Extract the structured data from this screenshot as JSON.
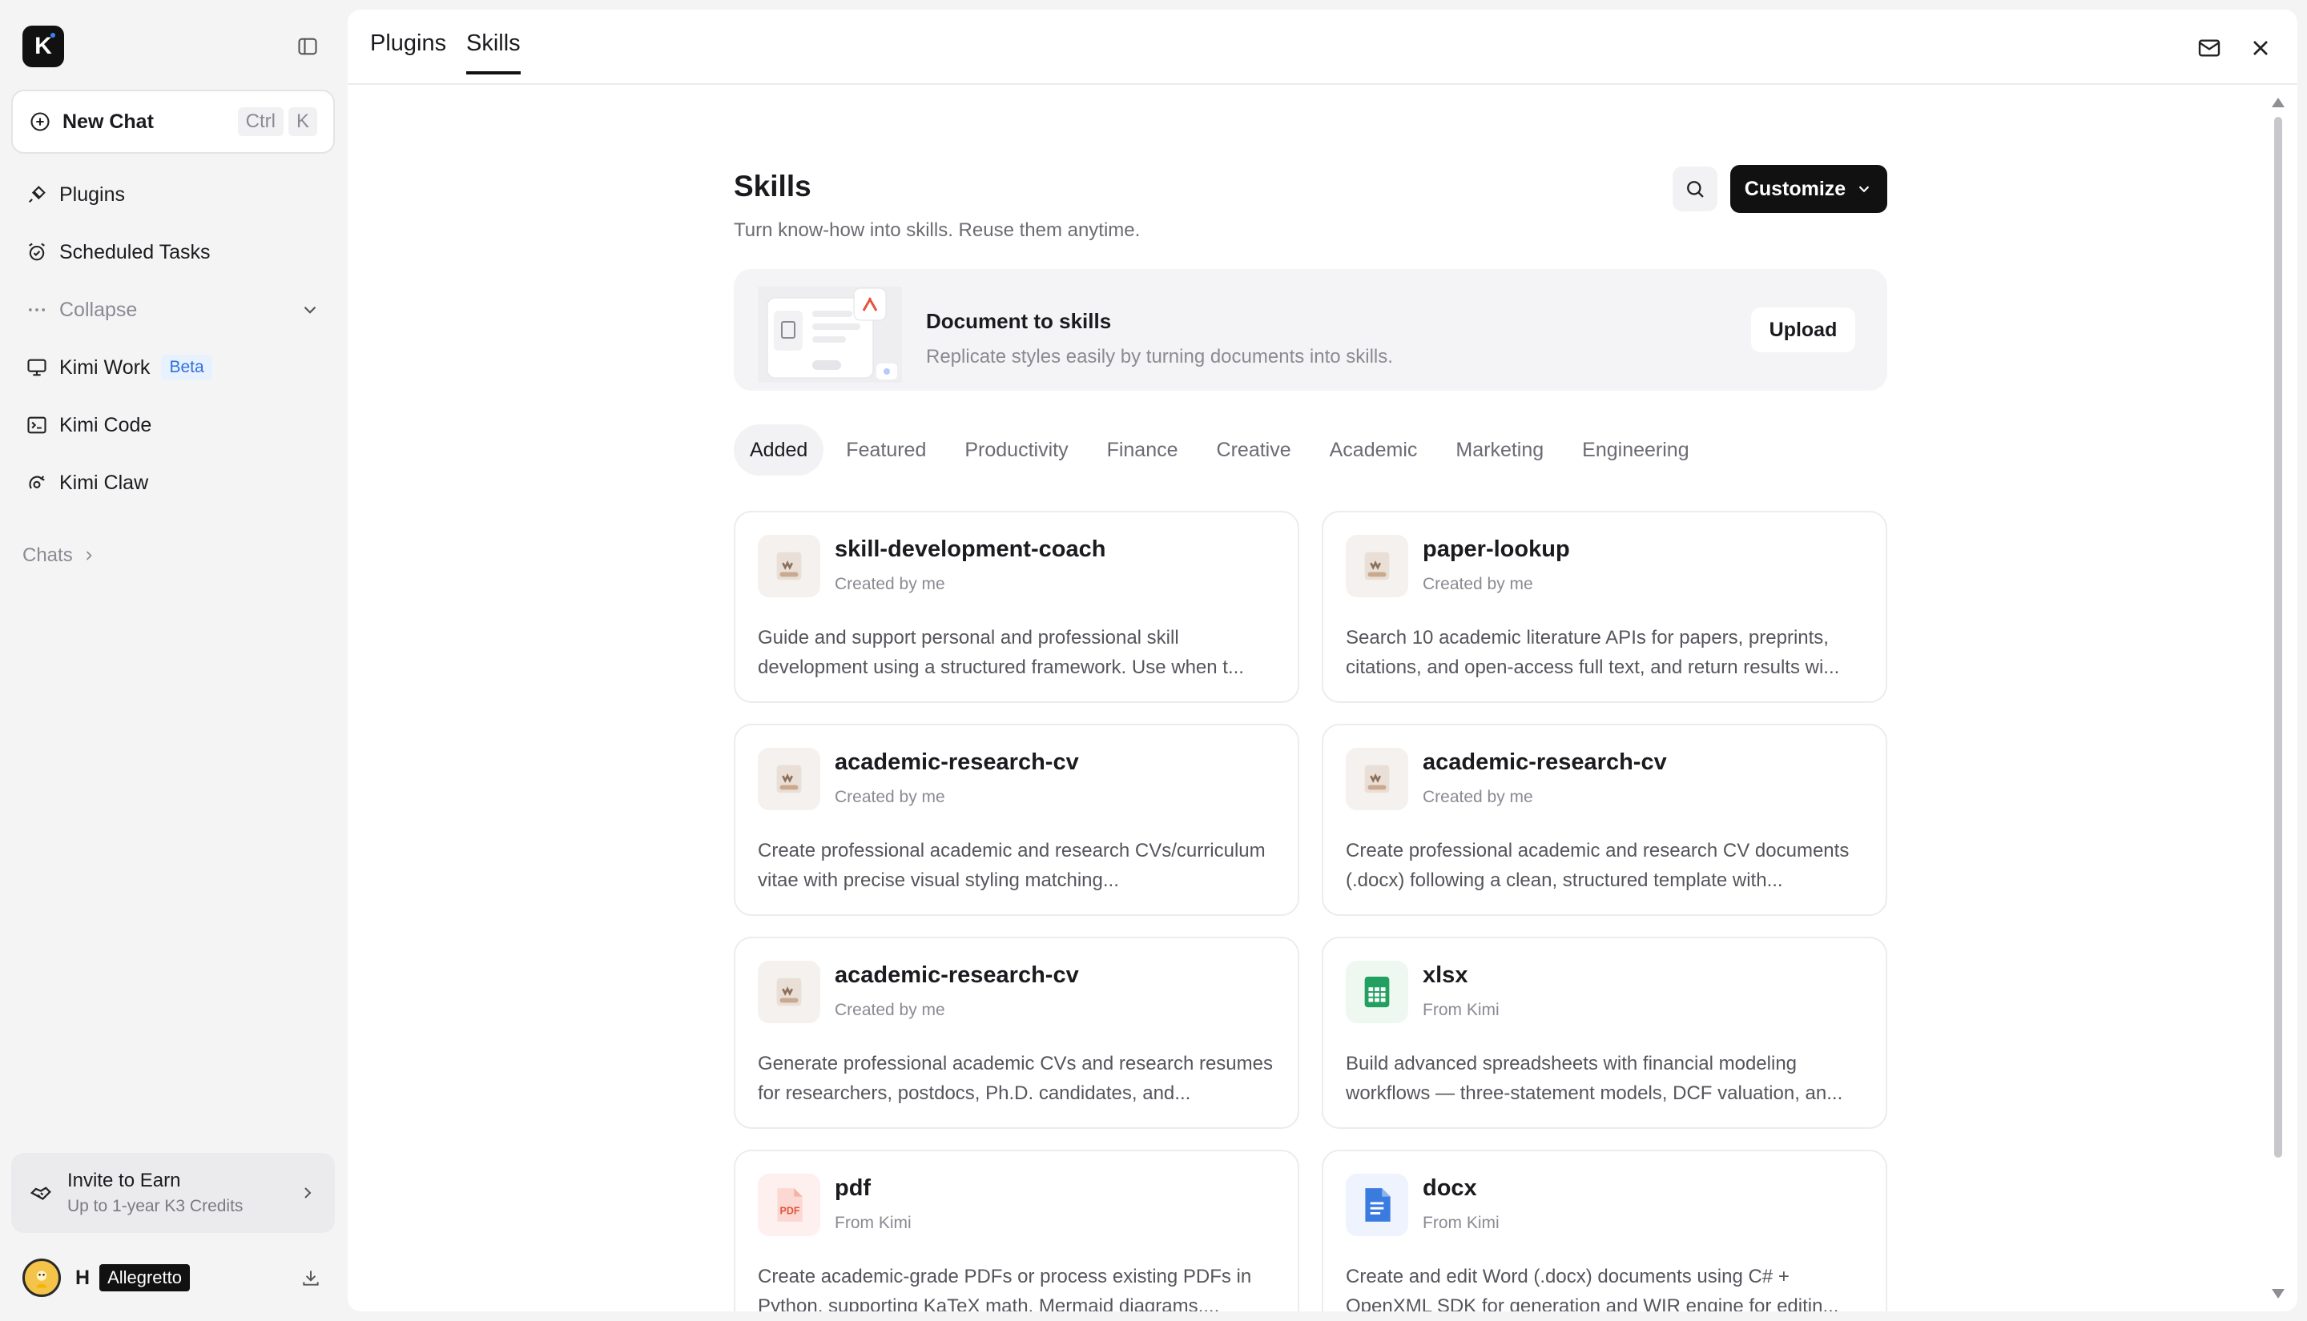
{
  "colors": {
    "primary_dark": "#111111",
    "beta_badge_bg": "#e8f1fe",
    "beta_badge_text": "#2f6fe0",
    "sidebar_bg": "#f4f4f5",
    "xlsx_green": "#22a060",
    "pdf_red": "#e5533d",
    "docx_blue": "#3a7be0"
  },
  "sidebar": {
    "logo_letter": "K",
    "new_chat": {
      "label": "New Chat",
      "shortcut": [
        "Ctrl",
        "K"
      ]
    },
    "items": [
      {
        "label": "Plugins",
        "icon": "plug-icon"
      },
      {
        "label": "Scheduled Tasks",
        "icon": "alarm-clock-icon"
      },
      {
        "label": "Collapse",
        "icon": "ellipsis-icon"
      },
      {
        "label": "Kimi Work",
        "icon": "monitor-icon",
        "badge": "Beta"
      },
      {
        "label": "Kimi Code",
        "icon": "terminal-icon"
      },
      {
        "label": "Kimi Claw",
        "icon": "claw-icon"
      }
    ],
    "chats_label": "Chats",
    "invite": {
      "title": "Invite to Earn",
      "subtitle": "Up to 1-year K3 Credits"
    },
    "user": {
      "initial": "H",
      "name": "Allegretto"
    }
  },
  "topbar": {
    "tabs": [
      "Plugins",
      "Skills"
    ],
    "active_tab": "Skills"
  },
  "page": {
    "title": "Skills",
    "subtitle": "Turn know-how into skills. Reuse them anytime.",
    "customize_label": "Customize",
    "banner": {
      "title": "Document to skills",
      "subtitle": "Replicate styles easily by turning documents into skills.",
      "button": "Upload"
    },
    "categories": [
      "Added",
      "Featured",
      "Productivity",
      "Finance",
      "Creative",
      "Academic",
      "Marketing",
      "Engineering"
    ],
    "active_category": "Added",
    "cards": [
      {
        "name": "skill-development-coach",
        "meta": "Created by me",
        "icon": "scroll-icon",
        "desc": "Guide and support personal and professional skill development using a structured framework. Use when t..."
      },
      {
        "name": "paper-lookup",
        "meta": "Created by me",
        "icon": "scroll-icon",
        "desc": "Search 10 academic literature APIs for papers, preprints, citations, and open-access full text, and return results wi..."
      },
      {
        "name": "academic-research-cv",
        "meta": "Created by me",
        "icon": "scroll-icon",
        "desc": "Create professional academic and research CVs/curriculum vitae with precise visual styling matching..."
      },
      {
        "name": "academic-research-cv",
        "meta": "Created by me",
        "icon": "scroll-icon",
        "desc": "Create professional academic and research CV documents (.docx) following a clean, structured template with..."
      },
      {
        "name": "academic-research-cv",
        "meta": "Created by me",
        "icon": "scroll-icon",
        "desc": "Generate professional academic CVs and research resumes for researchers, postdocs, Ph.D. candidates, and..."
      },
      {
        "name": "xlsx",
        "meta": "From Kimi",
        "icon": "spreadsheet-icon",
        "desc": "Build advanced spreadsheets with financial modeling workflows — three-statement models, DCF valuation, an..."
      },
      {
        "name": "pdf",
        "meta": "From Kimi",
        "icon": "pdf-file-icon",
        "icon_text": "PDF",
        "desc": "Create academic-grade PDFs or process existing PDFs in Python, supporting KaTeX math, Mermaid diagrams,..."
      },
      {
        "name": "docx",
        "meta": "From Kimi",
        "icon": "word-document-icon",
        "desc": "Create and edit Word (.docx) documents using C# + OpenXML SDK for generation and WIR engine for editin..."
      }
    ]
  }
}
